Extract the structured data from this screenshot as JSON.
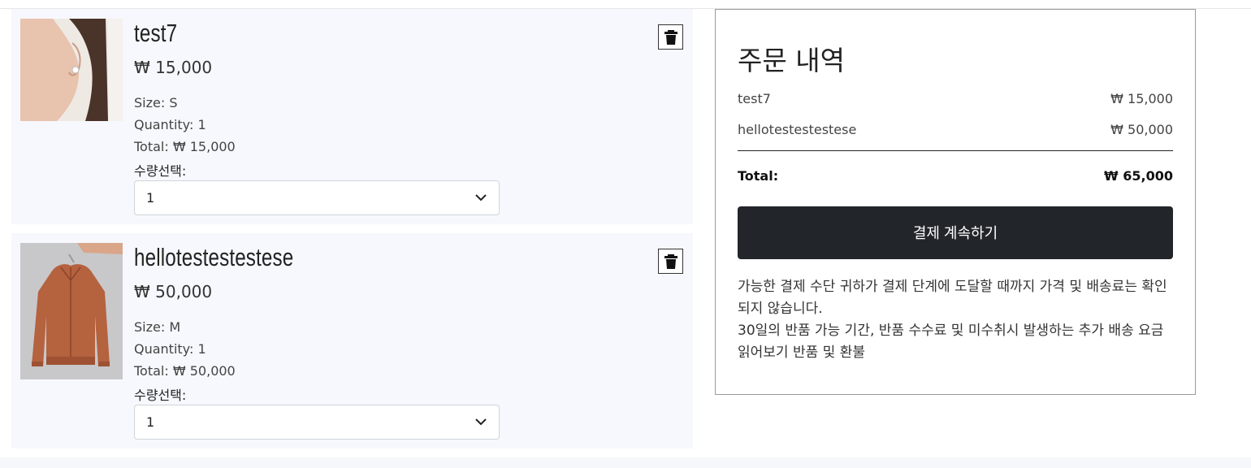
{
  "cart": {
    "items": [
      {
        "name": "test7",
        "price": "₩ 15,000",
        "size": "Size: S",
        "quantity": "Quantity: 1",
        "total": "Total: ₩ 15,000",
        "select_label": "수량선택:",
        "selected_qty": "1",
        "image_icon": "earring-model-photo"
      },
      {
        "name": "hellotestestestese",
        "price": "₩ 50,000",
        "size": "Size: M",
        "quantity": "Quantity: 1",
        "total": "Total: ₩ 50,000",
        "select_label": "수량선택:",
        "selected_qty": "1",
        "image_icon": "jacket-photo"
      }
    ],
    "delete_icon": "trash-icon"
  },
  "summary": {
    "title": "주문 내역",
    "lines": [
      {
        "name": "test7",
        "price": "₩ 15,000"
      },
      {
        "name": "hellotestestestese",
        "price": "₩ 50,000"
      }
    ],
    "total_label": "Total:",
    "total_value": "₩ 65,000",
    "checkout_label": "결제 계속하기",
    "notice_line1": "가능한 결제 수단 귀하가 결제 단계에 도달할 때까지 가격 및 배송료는 확인되지 않습니다.",
    "notice_line2": "30일의 반품 가능 기간, 반품 수수료 및 미수취시 발생하는 추가 배송 요금 읽어보기 반품 및 환불"
  },
  "colors": {
    "item_bg": "#f7f8fd",
    "button_dark": "#22252a",
    "jacket": "#b5623f"
  }
}
